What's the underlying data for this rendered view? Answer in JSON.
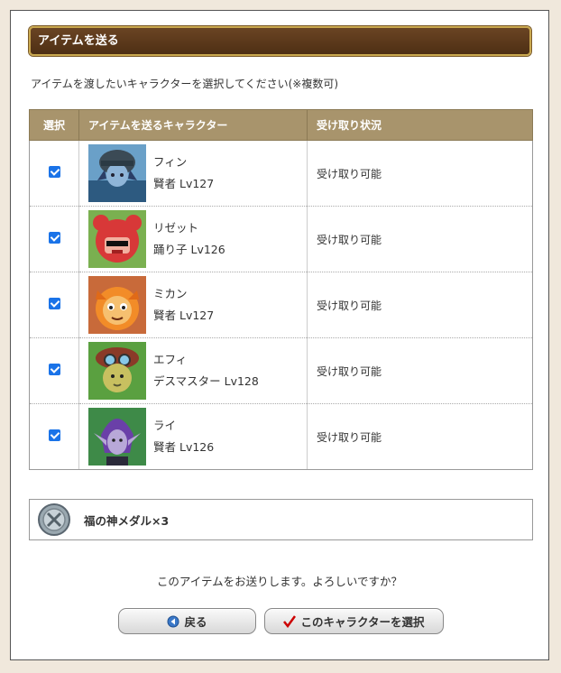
{
  "section_title": "アイテムを送る",
  "instruction": "アイテムを渡したいキャラクターを選択してください(※複数可)",
  "table": {
    "headers": {
      "select": "選択",
      "character": "アイテムを送るキャラクター",
      "status": "受け取り状況"
    },
    "rows": [
      {
        "checked": true,
        "name": "フィン",
        "job_level": "賢者 Lv127",
        "status": "受け取り可能",
        "avatar_icon": "character-portrait-fin-icon"
      },
      {
        "checked": true,
        "name": "リゼット",
        "job_level": "踊り子 Lv126",
        "status": "受け取り可能",
        "avatar_icon": "character-portrait-lizette-icon"
      },
      {
        "checked": true,
        "name": "ミカン",
        "job_level": "賢者 Lv127",
        "status": "受け取り可能",
        "avatar_icon": "character-portrait-mikan-icon"
      },
      {
        "checked": true,
        "name": "エフィ",
        "job_level": "デスマスター Lv128",
        "status": "受け取り可能",
        "avatar_icon": "character-portrait-efi-icon"
      },
      {
        "checked": true,
        "name": "ライ",
        "job_level": "賢者 Lv126",
        "status": "受け取り可能",
        "avatar_icon": "character-portrait-rai-icon"
      }
    ]
  },
  "item": {
    "name": "福の神メダル×3",
    "icon": "medal-icon"
  },
  "confirm_text": "このアイテムをお送りします。よろしいですか？",
  "buttons": {
    "back": "戻る",
    "select": "このキャラクターを選択"
  },
  "colors": {
    "header_brown": "#5a3719",
    "header_border": "#c9a84f",
    "table_header": "#a8946c",
    "checkbox": "#1a73e8",
    "select_check": "#cc0000"
  }
}
